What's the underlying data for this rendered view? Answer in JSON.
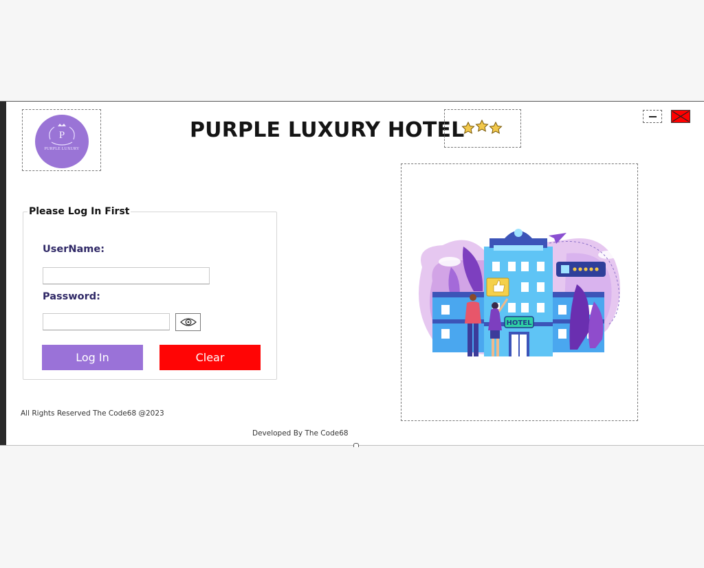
{
  "window": {
    "title": "PURPLE LUXURY HOTEL",
    "minimize_icon": "minus-icon",
    "close_icon": "close-x-icon"
  },
  "logo": {
    "letter": "P",
    "text": "PURPLE LUXURY",
    "color": "#9a74d6"
  },
  "rating": {
    "stars": 3,
    "icon": "star-icon",
    "color": "#f2c84b"
  },
  "login": {
    "group_title": "Please Log In First",
    "username_label": "UserName:",
    "username_value": "",
    "password_label": "Password:",
    "password_value": "",
    "show_password_icon": "eye-icon",
    "login_button": "Log In",
    "clear_button": "Clear",
    "login_color": "#9a72d8",
    "clear_color": "#ff0505"
  },
  "illustration": {
    "sign_text": "HOTEL",
    "review_icon": "rating-card-icon",
    "description_icon": "hotel-illustration"
  },
  "footer": {
    "rights": "All Rights Reserved The Code68 @2023",
    "developer": "Developed By The Code68"
  }
}
